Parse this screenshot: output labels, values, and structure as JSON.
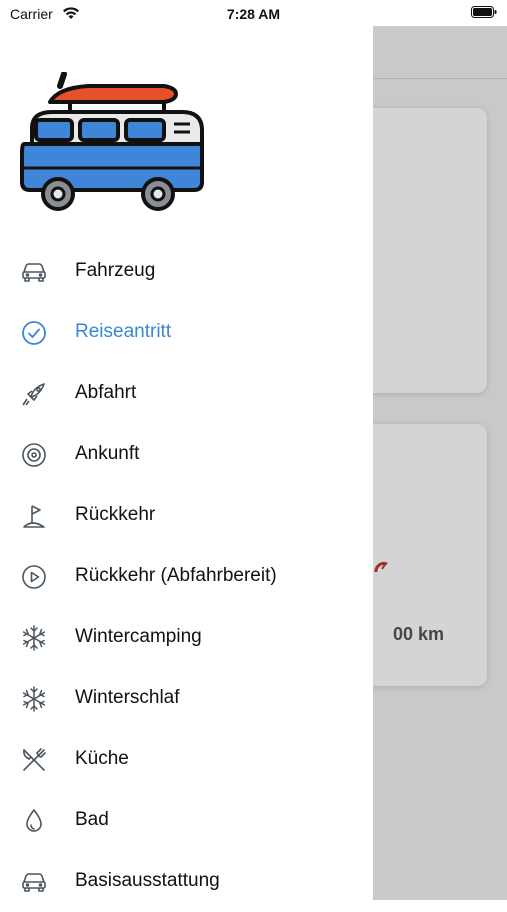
{
  "status_bar": {
    "carrier": "Carrier",
    "time": "7:28 AM",
    "wifi_icon": "wifi-icon",
    "battery_icon": "battery-icon"
  },
  "background": {
    "distance_text": "00 km"
  },
  "drawer": {
    "logo_icon": "campervan-logo-icon",
    "active_color": "#3a86d6",
    "items": [
      {
        "label": "Fahrzeug",
        "icon": "car-icon"
      },
      {
        "label": "Reiseantritt",
        "icon": "check-circle-icon",
        "active": true
      },
      {
        "label": "Abfahrt",
        "icon": "rocket-icon"
      },
      {
        "label": "Ankunft",
        "icon": "target-icon"
      },
      {
        "label": "Rückkehr",
        "icon": "flag-icon"
      },
      {
        "label": "Rückkehr (Abfahrbereit)",
        "icon": "play-circle-icon"
      },
      {
        "label": "Wintercamping",
        "icon": "snowflake-icon"
      },
      {
        "label": "Winterschlaf",
        "icon": "snowflake-icon"
      },
      {
        "label": "Küche",
        "icon": "fork-knife-icon"
      },
      {
        "label": "Bad",
        "icon": "droplet-icon"
      },
      {
        "label": "Basisausstattung",
        "icon": "car-icon"
      }
    ]
  }
}
